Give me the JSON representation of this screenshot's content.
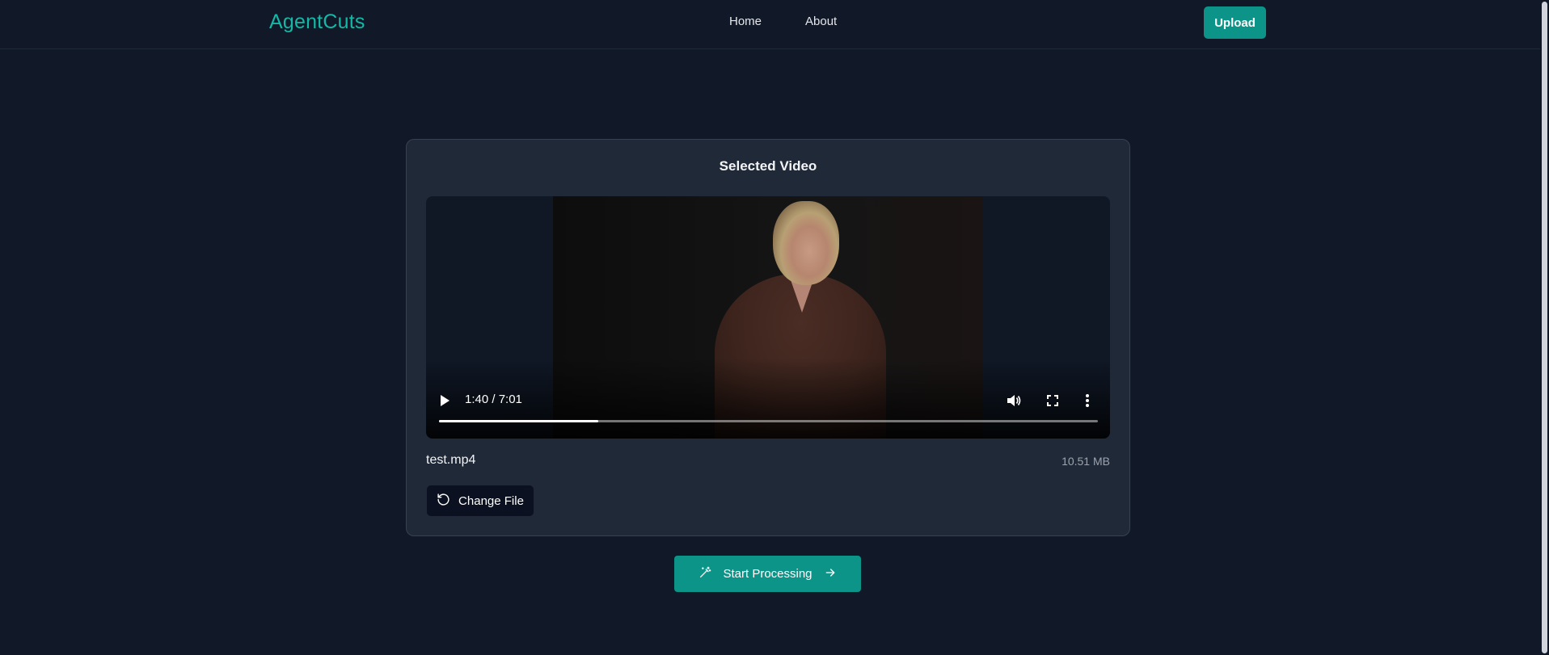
{
  "header": {
    "logo": "AgentCuts",
    "nav": [
      {
        "label": "Home"
      },
      {
        "label": "About"
      }
    ],
    "upload_label": "Upload"
  },
  "card": {
    "title": "Selected Video",
    "video": {
      "time_display": "1:40 / 7:01",
      "progress_fraction": 0.2418
    },
    "file_name": "test.mp4",
    "file_size": "10.51 MB",
    "change_label": "Change File"
  },
  "start_label": "Start Processing",
  "colors": {
    "accent": "#0d9488",
    "logo": "#14b8a6",
    "background": "#111827",
    "card": "#1f2937"
  },
  "icons": {
    "play": "play-icon",
    "volume": "volume-icon",
    "fullscreen": "fullscreen-icon",
    "menu": "more-vertical-icon",
    "change": "rotate-ccw-icon",
    "magic": "wand-icon",
    "arrow": "arrow-right-icon"
  }
}
